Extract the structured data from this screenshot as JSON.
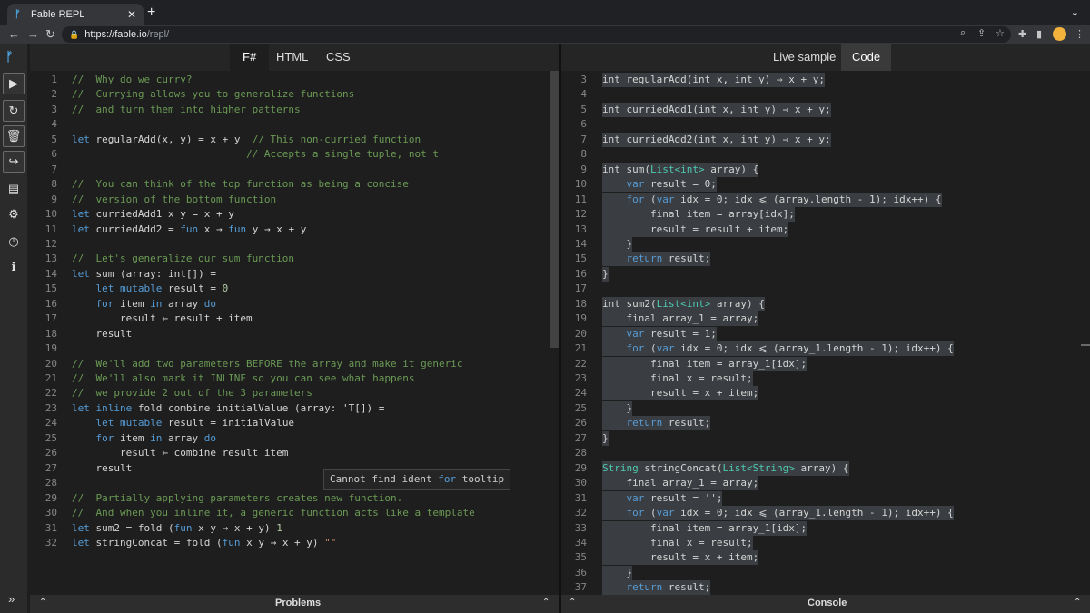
{
  "browser": {
    "tab_title": "Fable REPL",
    "tab_close": "✕",
    "new_tab": "+",
    "url_host": "https://fable.io",
    "url_path": "/repl/"
  },
  "left_tabs": [
    "F#",
    "HTML",
    "CSS"
  ],
  "right_tabs": [
    "Live sample",
    "Code"
  ],
  "left_code": [
    {
      "n": "1",
      "t": [
        [
          "cm",
          "//  Why do we curry?"
        ]
      ]
    },
    {
      "n": "2",
      "t": [
        [
          "cm",
          "//  Currying allows you to generalize functions"
        ]
      ]
    },
    {
      "n": "3",
      "t": [
        [
          "cm",
          "//  and turn them into higher patterns"
        ]
      ]
    },
    {
      "n": "4",
      "t": []
    },
    {
      "n": "5",
      "t": [
        [
          "kw",
          "let"
        ],
        [
          "",
          "regularAdd(x, y) = x + y  "
        ],
        [
          "cm",
          "// This non-curried function"
        ]
      ]
    },
    {
      "n": "6",
      "t": [
        [
          "",
          "                             "
        ],
        [
          "cm",
          "// Accepts a single tuple, not t"
        ]
      ]
    },
    {
      "n": "7",
      "t": []
    },
    {
      "n": "8",
      "t": [
        [
          "cm",
          "//  You can think of the top function as being a concise"
        ]
      ]
    },
    {
      "n": "9",
      "t": [
        [
          "cm",
          "//  version of the bottom function"
        ]
      ]
    },
    {
      "n": "10",
      "t": [
        [
          "kw",
          "let"
        ],
        [
          "",
          "curriedAdd1 x y = x + y"
        ]
      ]
    },
    {
      "n": "11",
      "t": [
        [
          "kw",
          "let"
        ],
        [
          "",
          "curriedAdd2 = "
        ],
        [
          "kw",
          "fun"
        ],
        [
          "",
          "x → "
        ],
        [
          "kw",
          "fun"
        ],
        [
          "",
          "y → x + y"
        ]
      ]
    },
    {
      "n": "12",
      "t": []
    },
    {
      "n": "13",
      "t": [
        [
          "cm",
          "//  Let's generalize our sum function"
        ]
      ]
    },
    {
      "n": "14",
      "t": [
        [
          "kw",
          "let"
        ],
        [
          "",
          "sum (array: int[]) ="
        ]
      ]
    },
    {
      "n": "15",
      "t": [
        [
          "",
          "    "
        ],
        [
          "kw",
          "let mutable"
        ],
        [
          "",
          "result = "
        ],
        [
          "num",
          "0"
        ]
      ]
    },
    {
      "n": "16",
      "t": [
        [
          "",
          "    "
        ],
        [
          "kw",
          "for"
        ],
        [
          "",
          "item "
        ],
        [
          "kw",
          "in"
        ],
        [
          "",
          "array "
        ],
        [
          "kw",
          "do"
        ]
      ]
    },
    {
      "n": "17",
      "t": [
        [
          "",
          "        result ← result + item"
        ]
      ]
    },
    {
      "n": "18",
      "t": [
        [
          "",
          "    result"
        ]
      ]
    },
    {
      "n": "19",
      "t": []
    },
    {
      "n": "20",
      "t": [
        [
          "cm",
          "//  We'll add two parameters BEFORE the array and make it generic"
        ]
      ]
    },
    {
      "n": "21",
      "t": [
        [
          "cm",
          "//  We'll also mark it INLINE so you can see what happens"
        ]
      ]
    },
    {
      "n": "22",
      "t": [
        [
          "cm",
          "//  we provide 2 out of the 3 parameters"
        ]
      ]
    },
    {
      "n": "23",
      "t": [
        [
          "kw",
          "let inline"
        ],
        [
          "",
          "fold combine initialValue (array: 'T[]) ="
        ]
      ]
    },
    {
      "n": "24",
      "t": [
        [
          "",
          "    "
        ],
        [
          "kw",
          "let mutable"
        ],
        [
          "",
          "result = initialValue"
        ]
      ]
    },
    {
      "n": "25",
      "t": [
        [
          "",
          "    "
        ],
        [
          "kw",
          "for"
        ],
        [
          "",
          "item "
        ],
        [
          "kw",
          "in"
        ],
        [
          "",
          "array "
        ],
        [
          "kw",
          "do"
        ]
      ]
    },
    {
      "n": "26",
      "t": [
        [
          "",
          "        result ← combine result item"
        ]
      ]
    },
    {
      "n": "27",
      "t": [
        [
          "",
          "    result"
        ]
      ]
    },
    {
      "n": "28",
      "t": []
    },
    {
      "n": "29",
      "t": [
        [
          "cm",
          "//  Partially applying parameters creates new function."
        ]
      ]
    },
    {
      "n": "30",
      "t": [
        [
          "cm",
          "//  And when you inline it, a generic function acts like a template"
        ]
      ]
    },
    {
      "n": "31",
      "t": [
        [
          "kw",
          "let"
        ],
        [
          "",
          "sum2 = fold ("
        ],
        [
          "kw",
          "fun"
        ],
        [
          "",
          "x y → x + y) "
        ],
        [
          "num",
          "1"
        ]
      ]
    },
    {
      "n": "32",
      "t": [
        [
          "kw",
          "let"
        ],
        [
          "",
          "stringConcat = fold ("
        ],
        [
          "kw",
          "fun"
        ],
        [
          "",
          "x y → x + y) "
        ],
        [
          "str",
          "\"\""
        ]
      ]
    }
  ],
  "right_code": [
    {
      "n": "3",
      "h": 1,
      "t": [
        [
          "",
          "int regularAdd(int x, int y) ⇒ x + y;"
        ]
      ]
    },
    {
      "n": "4",
      "t": []
    },
    {
      "n": "5",
      "h": 1,
      "t": [
        [
          "",
          "int curriedAdd1(int x, int y) ⇒ x + y;"
        ]
      ]
    },
    {
      "n": "6",
      "t": []
    },
    {
      "n": "7",
      "h": 1,
      "t": [
        [
          "",
          "int curriedAdd2(int x, int y) ⇒ x + y;"
        ]
      ]
    },
    {
      "n": "8",
      "t": []
    },
    {
      "n": "9",
      "h": 1,
      "t": [
        [
          "",
          "int sum("
        ],
        [
          "ty",
          "List<int>"
        ],
        [
          "",
          "array) {"
        ]
      ]
    },
    {
      "n": "10",
      "h": 1,
      "t": [
        [
          "",
          "    "
        ],
        [
          "kw",
          "var"
        ],
        [
          "",
          "result = 0;"
        ]
      ]
    },
    {
      "n": "11",
      "h": 1,
      "t": [
        [
          "",
          "    "
        ],
        [
          "kw",
          "for"
        ],
        [
          "",
          "("
        ],
        [
          "kw",
          "var"
        ],
        [
          "",
          "idx = 0; idx ⩽ (array.length - 1); idx++) {"
        ]
      ]
    },
    {
      "n": "12",
      "h": 1,
      "t": [
        [
          "",
          "        final item = array[idx];"
        ]
      ]
    },
    {
      "n": "13",
      "h": 1,
      "t": [
        [
          "",
          "        result = result + item;"
        ]
      ]
    },
    {
      "n": "14",
      "h": 1,
      "t": [
        [
          "",
          "    }"
        ]
      ]
    },
    {
      "n": "15",
      "h": 1,
      "t": [
        [
          "",
          "    "
        ],
        [
          "kw",
          "return"
        ],
        [
          "",
          "result;"
        ]
      ]
    },
    {
      "n": "16",
      "h": 1,
      "t": [
        [
          "",
          "}"
        ]
      ]
    },
    {
      "n": "17",
      "t": []
    },
    {
      "n": "18",
      "h": 1,
      "t": [
        [
          "",
          "int sum2("
        ],
        [
          "ty",
          "List<int>"
        ],
        [
          "",
          "array) {"
        ]
      ]
    },
    {
      "n": "19",
      "h": 1,
      "t": [
        [
          "",
          "    final array_1 = array;"
        ]
      ]
    },
    {
      "n": "20",
      "h": 1,
      "t": [
        [
          "",
          "    "
        ],
        [
          "kw",
          "var"
        ],
        [
          "",
          "result = 1;"
        ]
      ]
    },
    {
      "n": "21",
      "h": 1,
      "t": [
        [
          "",
          "    "
        ],
        [
          "kw",
          "for"
        ],
        [
          "",
          "("
        ],
        [
          "kw",
          "var"
        ],
        [
          "",
          "idx = 0; idx ⩽ (array_1.length - 1); idx++) {"
        ]
      ]
    },
    {
      "n": "22",
      "h": 1,
      "t": [
        [
          "",
          "        final item = array_1[idx];"
        ]
      ]
    },
    {
      "n": "23",
      "h": 1,
      "t": [
        [
          "",
          "        final x = result;"
        ]
      ]
    },
    {
      "n": "24",
      "h": 1,
      "t": [
        [
          "",
          "        result = x + item;"
        ]
      ]
    },
    {
      "n": "25",
      "h": 1,
      "t": [
        [
          "",
          "    }"
        ]
      ]
    },
    {
      "n": "26",
      "h": 1,
      "t": [
        [
          "",
          "    "
        ],
        [
          "kw",
          "return"
        ],
        [
          "",
          "result;"
        ]
      ]
    },
    {
      "n": "27",
      "h": 1,
      "t": [
        [
          "",
          "}"
        ]
      ]
    },
    {
      "n": "28",
      "t": []
    },
    {
      "n": "29",
      "h": 1,
      "t": [
        [
          "ty",
          "String"
        ],
        [
          "",
          "stringConcat("
        ],
        [
          "ty",
          "List<String>"
        ],
        [
          "",
          "array) {"
        ]
      ]
    },
    {
      "n": "30",
      "h": 1,
      "t": [
        [
          "",
          "    final array_1 = array;"
        ]
      ]
    },
    {
      "n": "31",
      "h": 1,
      "t": [
        [
          "",
          "    "
        ],
        [
          "kw",
          "var"
        ],
        [
          "",
          "result = '';"
        ]
      ]
    },
    {
      "n": "32",
      "h": 1,
      "t": [
        [
          "",
          "    "
        ],
        [
          "kw",
          "for"
        ],
        [
          "",
          "("
        ],
        [
          "kw",
          "var"
        ],
        [
          "",
          "idx = 0; idx ⩽ (array_1.length - 1); idx++) {"
        ]
      ]
    },
    {
      "n": "33",
      "h": 1,
      "t": [
        [
          "",
          "        final item = array_1[idx];"
        ]
      ]
    },
    {
      "n": "34",
      "h": 1,
      "t": [
        [
          "",
          "        final x = result;"
        ]
      ]
    },
    {
      "n": "35",
      "h": 1,
      "t": [
        [
          "",
          "        result = x + item;"
        ]
      ]
    },
    {
      "n": "36",
      "h": 1,
      "t": [
        [
          "",
          "    }"
        ]
      ]
    },
    {
      "n": "37",
      "h": 1,
      "t": [
        [
          "",
          "    "
        ],
        [
          "kw",
          "return"
        ],
        [
          "",
          "result;"
        ]
      ]
    }
  ],
  "tooltip": {
    "pre": "Cannot find ident ",
    "kw": "for",
    "post": " tooltip"
  },
  "bottom": {
    "problems": "Problems",
    "console": "Console"
  },
  "icons": {
    "run": "play-icon",
    "refresh": "refresh-icon",
    "delete": "trash-icon",
    "share": "share-icon",
    "samples": "book-icon",
    "settings": "gear-icon",
    "history": "clock-icon",
    "about": "info-icon"
  },
  "colors": {
    "keyword": "#569cd6",
    "comment": "#6a9955",
    "type": "#4ec9b0",
    "accent": "#4ea4e0"
  }
}
